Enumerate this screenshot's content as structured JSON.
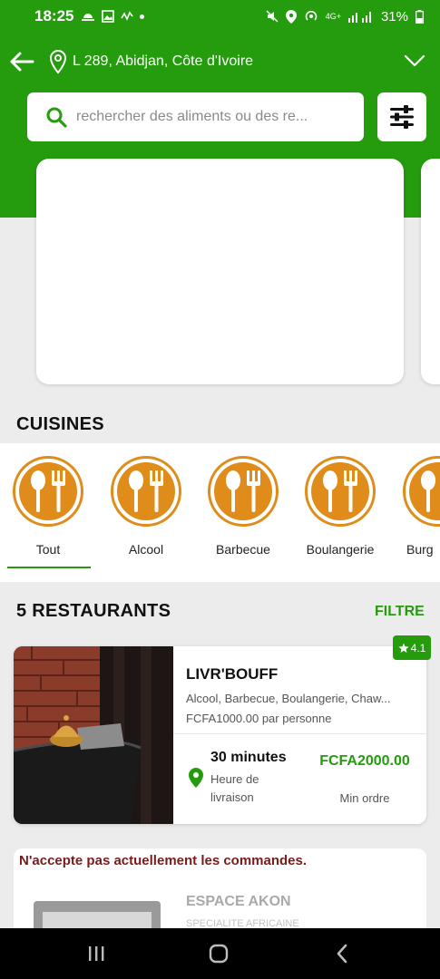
{
  "status_bar": {
    "time": "18:25",
    "network": "4G+",
    "battery": "31%"
  },
  "header": {
    "location": "L 289, Abidjan, Côte d'Ivoire"
  },
  "search": {
    "placeholder": "rechercher des aliments ou des re..."
  },
  "cuisines": {
    "title": "CUISINES",
    "items": [
      {
        "label": "Tout"
      },
      {
        "label": "Alcool"
      },
      {
        "label": "Barbecue"
      },
      {
        "label": "Boulangerie"
      },
      {
        "label": "Burg"
      }
    ],
    "selected": "Tout"
  },
  "restaurants": {
    "title": "5 RESTAURANTS",
    "filter_label": "FILTRE",
    "items": [
      {
        "rating": "4.1",
        "name": "LIVR'BOUFF",
        "cuisines": "Alcool, Barbecue, Boulangerie, Chaw...",
        "price": "FCFA1000.00 par personne",
        "delivery_time": "30 minutes",
        "delivery_label": "Heure de livraison",
        "min_order_value": "FCFA2000.00",
        "min_order_label": "Min ordre"
      }
    ],
    "closed": {
      "notice": "N'accepte pas actuellement les commandes.",
      "name": "ESPACE AKON",
      "subtitle": "SPECIALITE AFRICAINE"
    }
  },
  "colors": {
    "brand_green": "#249c0e",
    "cuisine_orange": "#df8c1a",
    "closed_red": "#7a1b1b"
  }
}
